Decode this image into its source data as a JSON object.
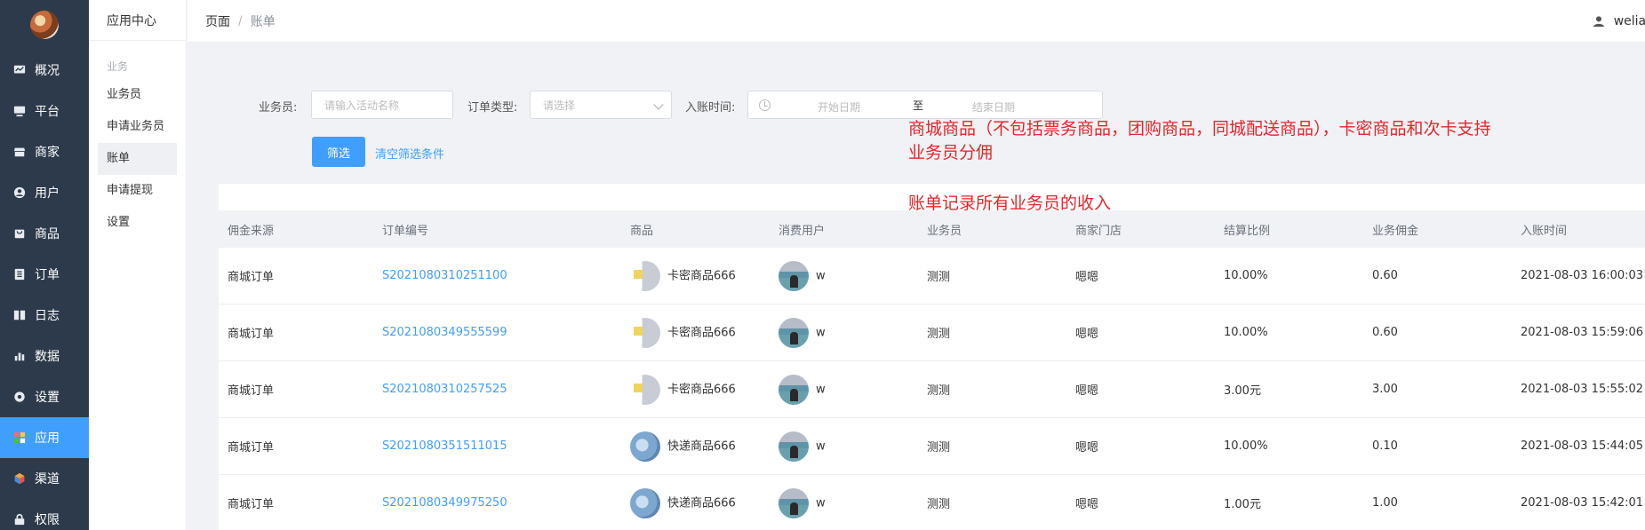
{
  "nav": {
    "items": [
      {
        "label": "概况",
        "icon": "monitor-chart-icon"
      },
      {
        "label": "平台",
        "icon": "desktop-icon"
      },
      {
        "label": "商家",
        "icon": "shop-icon"
      },
      {
        "label": "用户",
        "icon": "user-circle-icon"
      },
      {
        "label": "商品",
        "icon": "goods-bag-icon"
      },
      {
        "label": "订单",
        "icon": "order-list-icon"
      },
      {
        "label": "日志",
        "icon": "book-icon"
      },
      {
        "label": "数据",
        "icon": "bar-chart-icon"
      },
      {
        "label": "设置",
        "icon": "gear-icon"
      },
      {
        "label": "应用",
        "icon": "apps-grid-icon",
        "active": true
      },
      {
        "label": "渠道",
        "icon": "cube-icon"
      },
      {
        "label": "权限",
        "icon": "lock-icon"
      }
    ]
  },
  "subnav": {
    "title": "应用中心",
    "group": "业务",
    "items": [
      "业务员",
      "申请业务员",
      "账单",
      "申请提现",
      "设置"
    ],
    "active_index": 2
  },
  "header": {
    "breadcrumb_root": "页面",
    "breadcrumb_sep": "/",
    "breadcrumb_current": "账单",
    "username": "welian"
  },
  "filter": {
    "salesman_label": "业务员:",
    "salesman_placeholder": "请输入活动名称",
    "order_type_label": "订单类型:",
    "order_type_placeholder": "请选择",
    "time_label": "入账时间:",
    "start_placeholder": "开始日期",
    "range_sep": "至",
    "end_placeholder": "结束日期",
    "filter_button": "筛选",
    "clear_link": "清空筛选条件"
  },
  "table": {
    "headers": [
      "佣金来源",
      "订单编号",
      "商品",
      "消费用户",
      "业务员",
      "商家门店",
      "结算比例",
      "业务佣金",
      "入账时间"
    ],
    "rows": [
      {
        "source": "商城订单",
        "order_no": "S2021080310251100",
        "goods": "卡密商品666",
        "goods_thumb": "card",
        "user": "w",
        "salesman": "测测",
        "store": "嗯嗯",
        "ratio": "10.00%",
        "commission": "0.60",
        "time": "2021-08-03 16:00:03"
      },
      {
        "source": "商城订单",
        "order_no": "S2021080349555599",
        "goods": "卡密商品666",
        "goods_thumb": "card",
        "user": "w",
        "salesman": "测测",
        "store": "嗯嗯",
        "ratio": "10.00%",
        "commission": "0.60",
        "time": "2021-08-03 15:59:06"
      },
      {
        "source": "商城订单",
        "order_no": "S2021080310257525",
        "goods": "卡密商品666",
        "goods_thumb": "card",
        "user": "w",
        "salesman": "测测",
        "store": "嗯嗯",
        "ratio": "3.00元",
        "commission": "3.00",
        "time": "2021-08-03 15:55:02"
      },
      {
        "source": "商城订单",
        "order_no": "S2021080351511015",
        "goods": "快递商品666",
        "goods_thumb": "express",
        "user": "w",
        "salesman": "测测",
        "store": "嗯嗯",
        "ratio": "10.00%",
        "commission": "0.10",
        "time": "2021-08-03 15:44:05"
      },
      {
        "source": "商城订单",
        "order_no": "S2021080349975250",
        "goods": "快递商品666",
        "goods_thumb": "express",
        "user": "w",
        "salesman": "测测",
        "store": "嗯嗯",
        "ratio": "1.00元",
        "commission": "1.00",
        "time": "2021-08-03 15:42:01"
      }
    ]
  },
  "annotations": {
    "line1": "商城商品（不包括票务商品，团购商品，同城配送商品），卡密商品和次卡支持",
    "line2": "业务员分佣",
    "line3": "账单记录所有业务员的收入"
  },
  "colors": {
    "nav_bg": "#2d3a4b",
    "accent": "#409eff",
    "annotation": "#e6262b"
  }
}
